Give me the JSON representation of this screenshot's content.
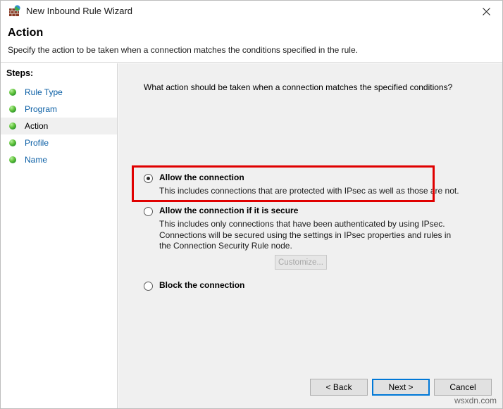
{
  "window": {
    "title": "New Inbound Rule Wizard",
    "icon": "firewall-globe-icon",
    "close_label": "✕"
  },
  "header": {
    "title": "Action",
    "subtitle": "Specify the action to be taken when a connection matches the conditions specified in the rule."
  },
  "sidebar": {
    "heading": "Steps:",
    "items": [
      {
        "label": "Rule Type",
        "current": false
      },
      {
        "label": "Program",
        "current": false
      },
      {
        "label": "Action",
        "current": true
      },
      {
        "label": "Profile",
        "current": false
      },
      {
        "label": "Name",
        "current": false
      }
    ]
  },
  "main": {
    "question": "What action should be taken when a connection matches the specified conditions?",
    "options": [
      {
        "title": "Allow the connection",
        "description": "This includes connections that are protected with IPsec as well as those are not.",
        "checked": true,
        "highlighted": true
      },
      {
        "title": "Allow the connection if it is secure",
        "description": "This includes only connections that have been authenticated by using IPsec.  Connections will be secured using the settings in IPsec properties and rules in the Connection Security Rule node.",
        "checked": false,
        "highlighted": false
      },
      {
        "title": "Block the connection",
        "description": "",
        "checked": false,
        "highlighted": false
      }
    ],
    "customize_label": "Customize..."
  },
  "footer": {
    "back_label": "< Back",
    "next_label": "Next >",
    "cancel_label": "Cancel"
  },
  "watermark": "wsxdn.com",
  "colors": {
    "accent": "#0078d7",
    "highlight": "#e00000",
    "link": "#0b5fa5",
    "bullet_green": "#27912a",
    "content_bg": "#f0f0f0"
  }
}
